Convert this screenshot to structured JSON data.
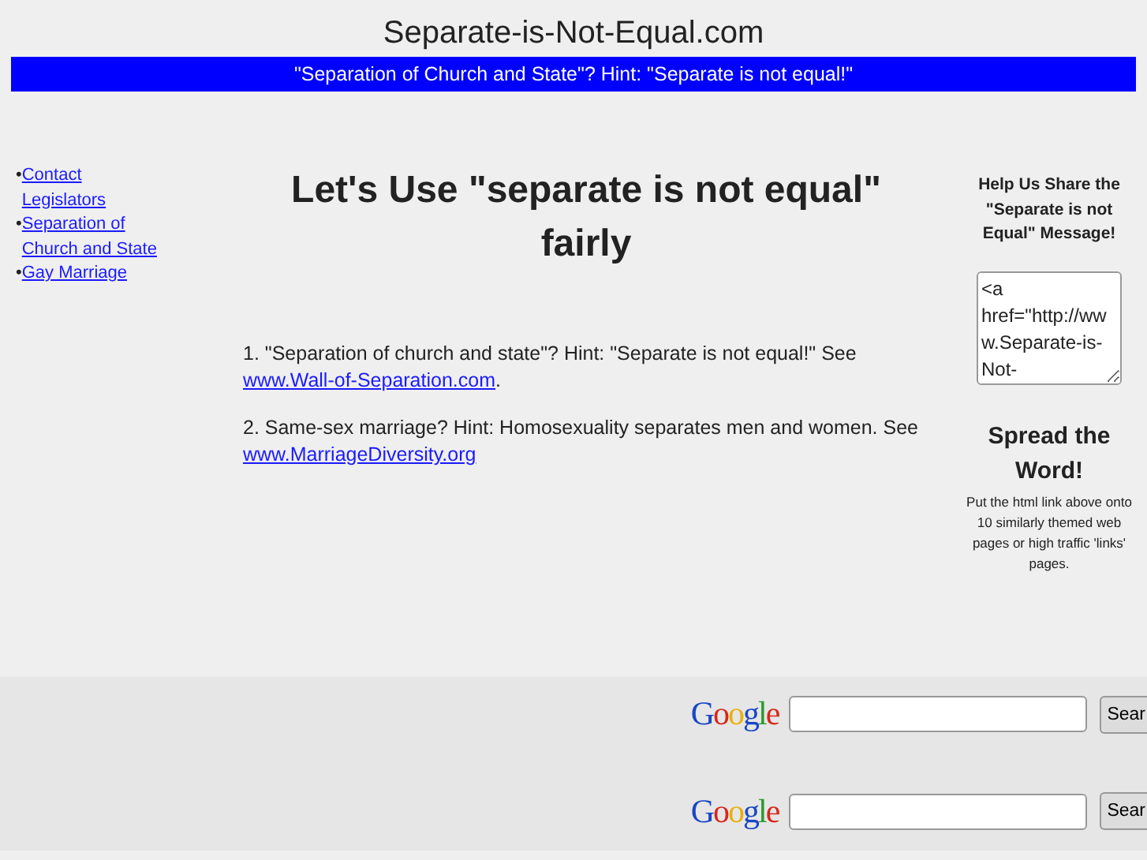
{
  "site_title": "Separate-is-Not-Equal.com",
  "banner": "\"Separation of Church and State\"? Hint: \"Separate is not equal!\"",
  "sidebar": {
    "items": [
      {
        "bullet": "•",
        "label": "Contact Legislators"
      },
      {
        "bullet": "•",
        "label": "Separation of Church and State"
      },
      {
        "bullet": "•",
        "label": "Gay Marriage"
      }
    ]
  },
  "heading": "Let's Use \"separate is not equal\" fairly",
  "paragraphs": [
    {
      "text": "1. \"Separation of church and state\"? Hint: \"Separate is not equal!\" See",
      "link": "www.Wall-of-Separation.com",
      "after": "."
    },
    {
      "text": "2. Same-sex marriage? Hint: Homosexuality separates men and women. See",
      "link": "www.MarriageDiversity.org"
    }
  ],
  "share": {
    "title": "Help Us Share the \"Separate is not Equal\" Message!",
    "code": "<a href=\"http://www.Separate-is-Not-",
    "spread_title": "Spread the Word!",
    "note": "Put the html link above onto 10 similarly themed web pages or high traffic 'links' pages."
  },
  "searches": [
    {
      "logo": "Google",
      "button": "Sear"
    },
    {
      "logo": "Google",
      "button": "Sear"
    }
  ]
}
